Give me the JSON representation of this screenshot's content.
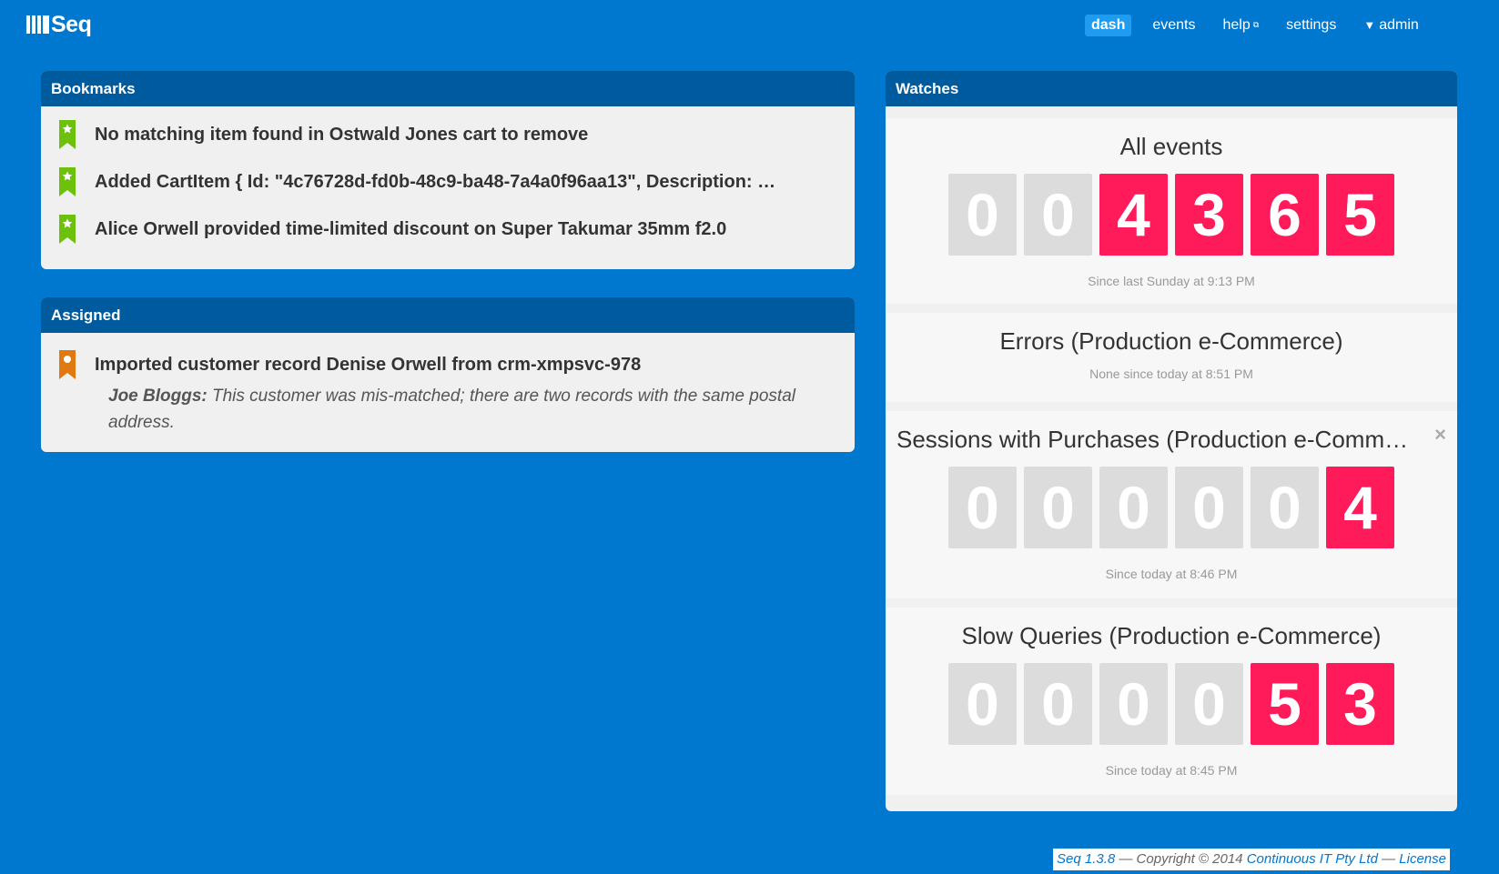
{
  "app": {
    "name": "Seq"
  },
  "nav": {
    "items": [
      {
        "label": "dash",
        "active": true
      },
      {
        "label": "events"
      },
      {
        "label": "help",
        "external": true
      },
      {
        "label": "settings"
      }
    ],
    "user": "admin"
  },
  "bookmarks": {
    "title": "Bookmarks",
    "items": [
      "No matching item found in Ostwald Jones cart to remove",
      "Added CartItem { Id: \"4c76728d-fd0b-48c9-ba48-7a4a0f96aa13\", Description: …",
      "Alice Orwell provided time-limited discount on Super Takumar 35mm f2.0"
    ]
  },
  "assigned": {
    "title": "Assigned",
    "items": [
      {
        "text": "Imported customer record Denise Orwell from crm-xmpsvc-978",
        "note_author": "Joe Bloggs:",
        "note_text": " This customer was mis-matched; there are two records with the same postal address."
      }
    ]
  },
  "watches": {
    "title": "Watches",
    "items": [
      {
        "title": "All events",
        "digits": [
          "0",
          "0",
          "4",
          "3",
          "6",
          "5"
        ],
        "lit": [
          false,
          false,
          true,
          true,
          true,
          true
        ],
        "since": "Since last Sunday at 9:13 PM"
      },
      {
        "title": "Errors (Production e-Commerce)",
        "digits": [],
        "since": "None since today at 8:51 PM"
      },
      {
        "title": "Sessions with Purchases (Production e-Commerce)",
        "digits": [
          "0",
          "0",
          "0",
          "0",
          "0",
          "4"
        ],
        "lit": [
          false,
          false,
          false,
          false,
          false,
          true
        ],
        "since": "Since today at 8:46 PM",
        "closable": true
      },
      {
        "title": "Slow Queries (Production e-Commerce)",
        "digits": [
          "0",
          "0",
          "0",
          "0",
          "5",
          "3"
        ],
        "lit": [
          false,
          false,
          false,
          false,
          true,
          true
        ],
        "since": "Since today at 8:45 PM"
      }
    ]
  },
  "footer": {
    "version": "Seq 1.3.8",
    "copyright": " — Copyright © 2014 ",
    "company": "Continuous IT Pty Ltd",
    "sep": " — ",
    "license": "License"
  },
  "colors": {
    "background": "#0078d0",
    "panel_header": "#005a9e",
    "digit_on": "#ff1a5a",
    "digit_off": "#dcdcdc",
    "bookmark_icon": "#6dc00c",
    "assigned_icon": "#e07a10"
  }
}
